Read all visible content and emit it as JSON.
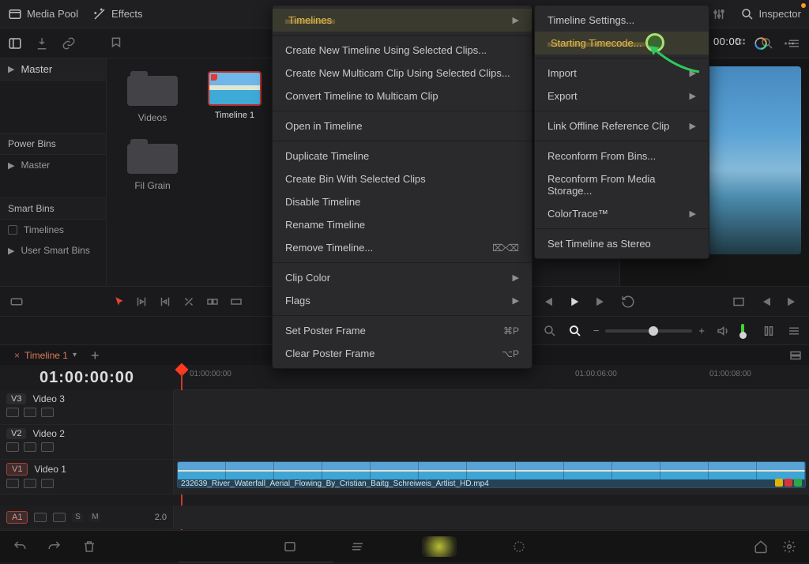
{
  "topbar": {
    "media_pool": "Media Pool",
    "effects": "Effects",
    "inspector": "Inspector"
  },
  "toolbar": {
    "timecode": "00:00"
  },
  "browser": {
    "master": "Master",
    "power_bins": "Power Bins",
    "power_master": "Master",
    "smart_bins": "Smart Bins",
    "timelines": "Timelines",
    "user_smart_bins": "User Smart Bins"
  },
  "pool": {
    "folder_videos": "Videos",
    "folder_filgrain": "Fil Grain",
    "thumb_timeline1": "Timeline 1"
  },
  "menu1": {
    "timelines": "Timelines",
    "create_new_timeline": "Create New Timeline Using Selected Clips...",
    "create_new_multicam": "Create New Multicam Clip Using Selected Clips...",
    "convert_multicam": "Convert Timeline to Multicam Clip",
    "open_in_timeline": "Open in Timeline",
    "duplicate": "Duplicate Timeline",
    "create_bin": "Create Bin With Selected Clips",
    "disable": "Disable Timeline",
    "rename": "Rename Timeline",
    "remove": "Remove Timeline...",
    "remove_sc": "⌦⌫",
    "clip_color": "Clip Color",
    "flags": "Flags",
    "set_poster": "Set Poster Frame",
    "set_poster_sc": "⌘P",
    "clear_poster": "Clear Poster Frame",
    "clear_poster_sc": "⌥P"
  },
  "menu2": {
    "timeline_settings": "Timeline Settings...",
    "starting_timecode": "Starting Timecode...",
    "import": "Import",
    "export": "Export",
    "link_offline": "Link Offline Reference Clip",
    "reconform_bins": "Reconform From Bins...",
    "reconform_media": "Reconform From Media Storage...",
    "colortrace": "ColorTrace™",
    "set_stereo": "Set Timeline as Stereo"
  },
  "tabs": {
    "timeline1": "Timeline 1"
  },
  "timeline": {
    "timecode": "01:00:00:00",
    "ruler_tick1": "01:00:00:00",
    "ruler_tick2": "01:00:06:00",
    "ruler_tick3": "01:00:08:00",
    "v3_badge": "V3",
    "v3_name": "Video 3",
    "v2_badge": "V2",
    "v2_name": "Video 2",
    "v1_badge": "V1",
    "v1_name": "Video 1",
    "a1_badge": "A1",
    "a1_num": "2.0",
    "sm_s": "S",
    "sm_m": "M",
    "clip_name": "232639_River_Waterfall_Aerial_Flowing_By_Cristian_Baitg_Schreiweis_Artlist_HD.mp4"
  }
}
